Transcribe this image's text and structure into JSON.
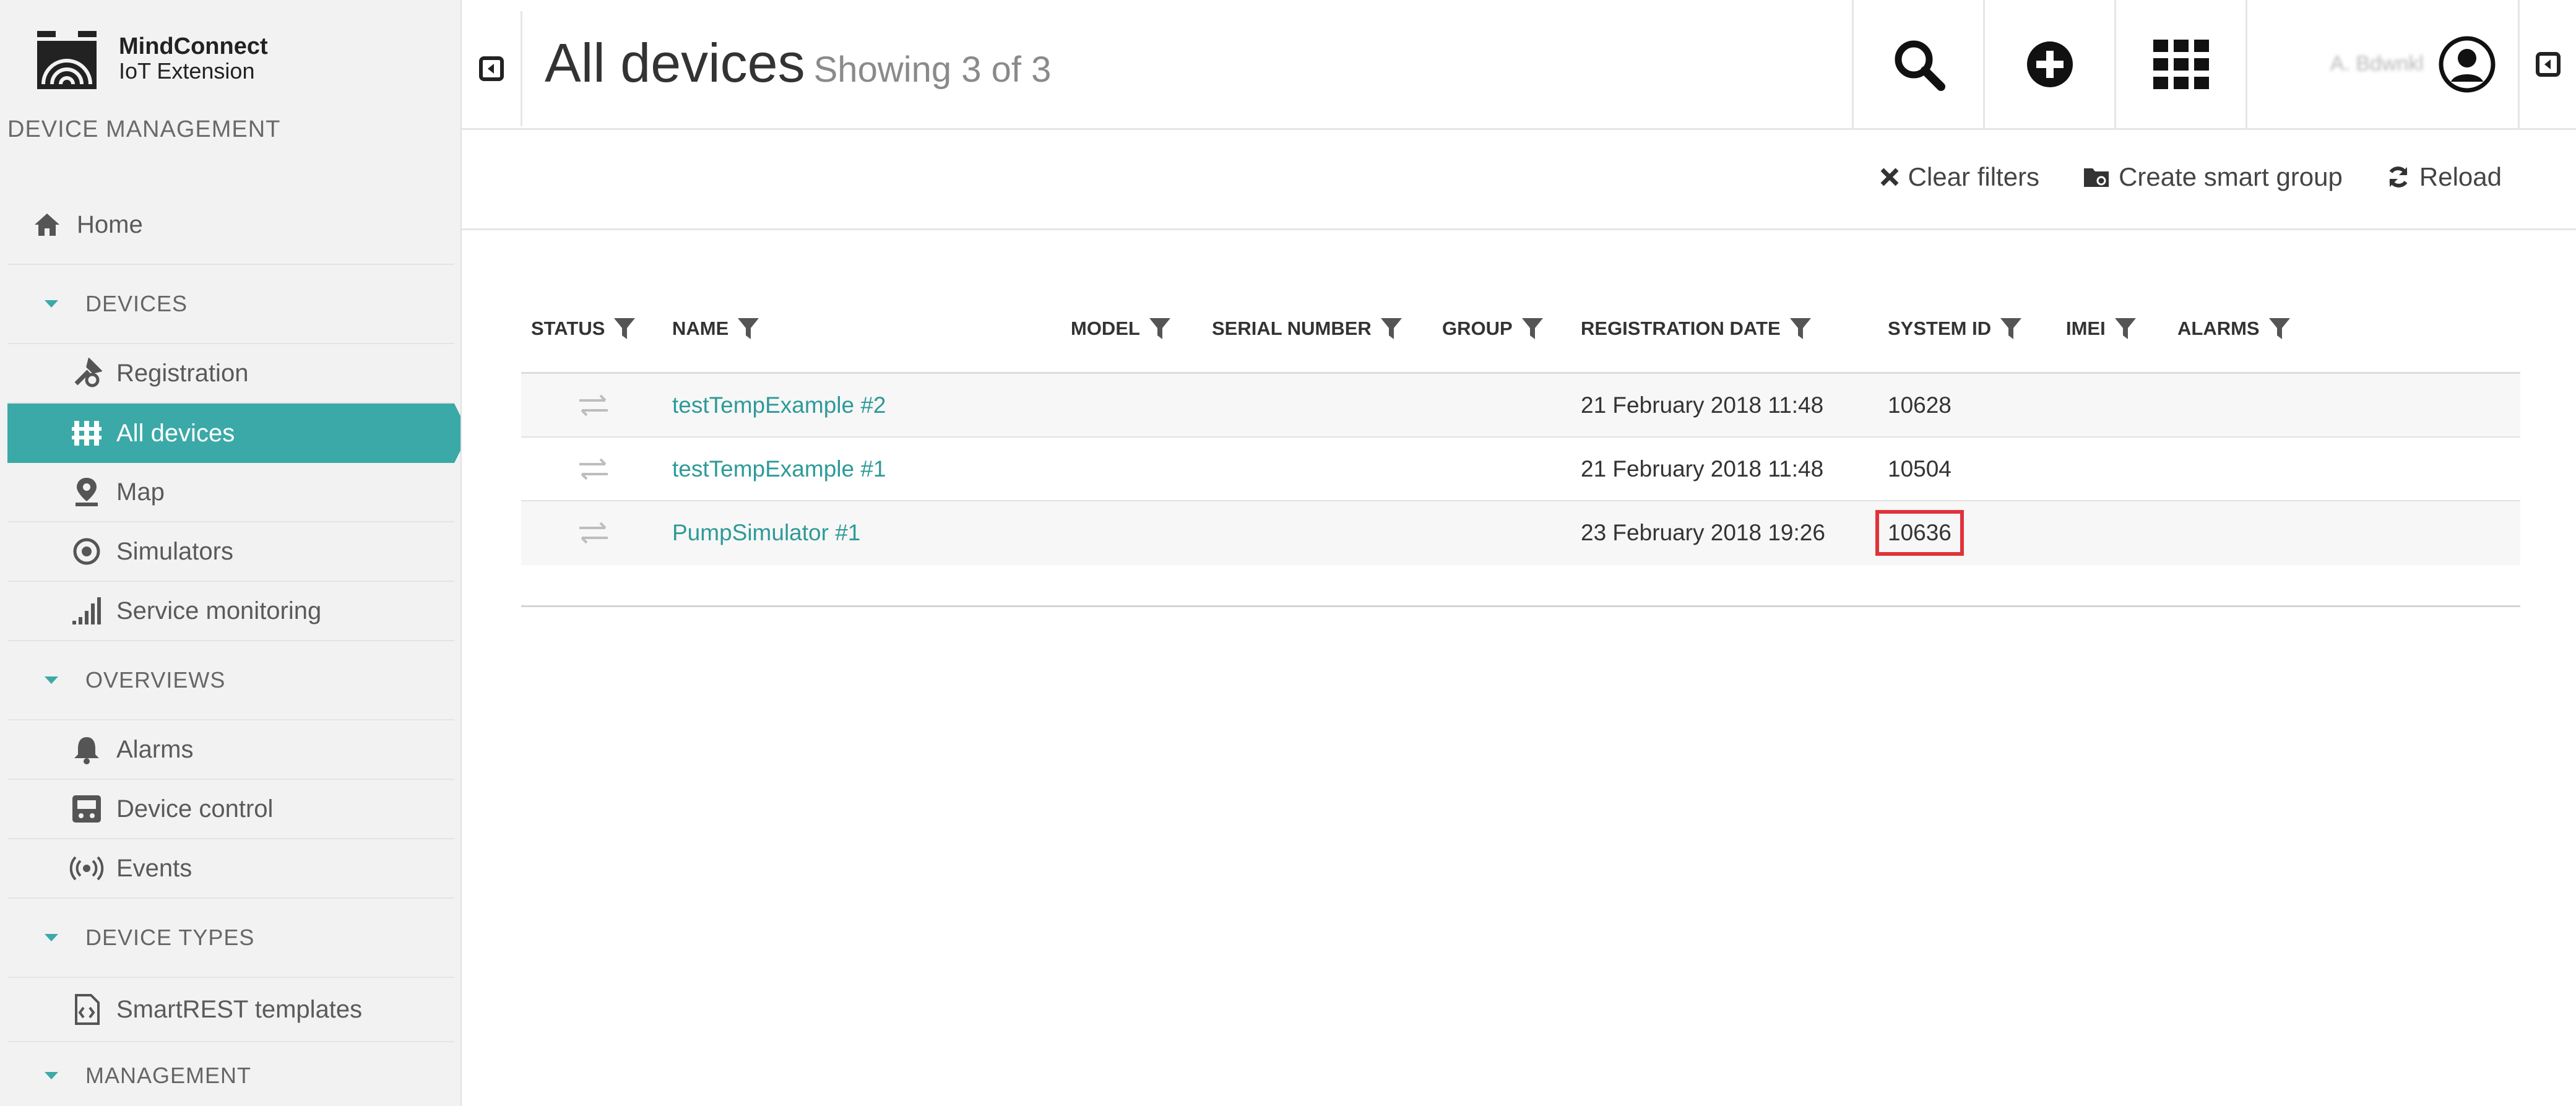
{
  "sidebar": {
    "brand": "MindConnect",
    "brand_sub": "IoT Extension",
    "section_title": "DEVICE MANAGEMENT",
    "home_label": "Home",
    "sections": {
      "devices": "DEVICES",
      "overviews": "OVERVIEWS",
      "device_types": "DEVICE TYPES",
      "management": "MANAGEMENT"
    },
    "items": {
      "registration": "Registration",
      "all_devices": "All devices",
      "map": "Map",
      "simulators": "Simulators",
      "service_monitoring": "Service monitoring",
      "alarms": "Alarms",
      "device_control": "Device control",
      "events": "Events",
      "smartrest": "SmartREST templates"
    },
    "accent_color": "#3ba9a7"
  },
  "header": {
    "title": "All devices",
    "subtitle": "Showing 3 of 3",
    "user_name": "A. Bdwnkl",
    "icons": [
      "search-icon",
      "add-icon",
      "app-grid-icon",
      "user-icon"
    ]
  },
  "toolbar": {
    "clear_filters": "Clear filters",
    "create_smart_group": "Create smart group",
    "reload": "Reload"
  },
  "table": {
    "columns": {
      "status": "STATUS",
      "name": "NAME",
      "model": "MODEL",
      "serial": "SERIAL NUMBER",
      "group": "GROUP",
      "registration_date": "REGISTRATION DATE",
      "system_id": "SYSTEM ID",
      "imei": "IMEI",
      "alarms": "ALARMS"
    },
    "rows": [
      {
        "name": "testTempExample #2",
        "model": "",
        "serial": "",
        "group": "",
        "registration_date": "21 February 2018 11:48",
        "system_id": "10628",
        "imei": "",
        "alarms": ""
      },
      {
        "name": "testTempExample #1",
        "model": "",
        "serial": "",
        "group": "",
        "registration_date": "21 February 2018 11:48",
        "system_id": "10504",
        "imei": "",
        "alarms": ""
      },
      {
        "name": "PumpSimulator #1",
        "model": "",
        "serial": "",
        "group": "",
        "registration_date": "23 February 2018 19:26",
        "system_id": "10636",
        "imei": "",
        "alarms": ""
      }
    ],
    "highlight_color": "#e0333a",
    "link_color": "#2e9a98"
  }
}
